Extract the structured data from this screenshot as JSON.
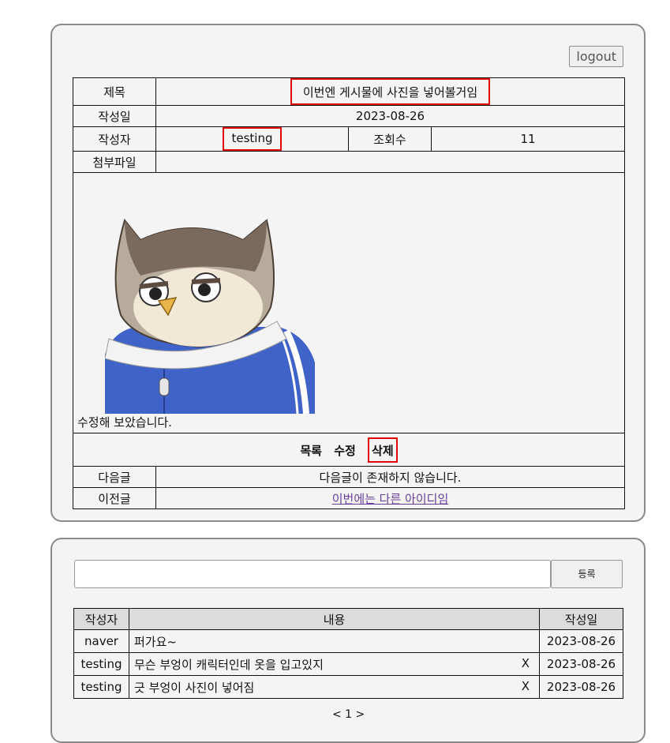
{
  "header": {
    "logout_label": "logout"
  },
  "post": {
    "title_label": "제목",
    "title": "이번엔 게시물에 사진을 넣어볼거임",
    "date_label": "작성일",
    "date": "2023-08-26",
    "writer_label": "작성자",
    "writer": "testing",
    "views_label": "조회수",
    "views": "11",
    "attachment_label": "첨부파일",
    "attachment": "",
    "content_text": "수정해 보았습니다."
  },
  "actions": {
    "list_label": "목록",
    "edit_label": "수정",
    "delete_label": "삭제"
  },
  "navigation": {
    "next_label": "다음글",
    "next_value": "다음글이 존재하지 않습니다.",
    "prev_label": "이전글",
    "prev_value": "이번에는 다른 아이디임"
  },
  "comment_form": {
    "input_value": "",
    "submit_label": "등록"
  },
  "comments": {
    "headers": [
      "작성자",
      "내용",
      "작성일"
    ],
    "delete_label": "X",
    "rows": [
      {
        "writer": "naver",
        "text": "퍼가요~",
        "date": "2023-08-26",
        "deletable": false
      },
      {
        "writer": "testing",
        "text": "무슨 부엉이 캐릭터인데 옷을 입고있지",
        "date": "2023-08-26",
        "deletable": true
      },
      {
        "writer": "testing",
        "text": "긋 부엉이 사진이 넣어짐",
        "date": "2023-08-26",
        "deletable": true
      }
    ]
  },
  "pagination": {
    "current": "< 1 >"
  },
  "colors": {
    "highlight": "#e00000",
    "link": "#6a3d9a",
    "panel_bg": "#f4f4f4"
  }
}
